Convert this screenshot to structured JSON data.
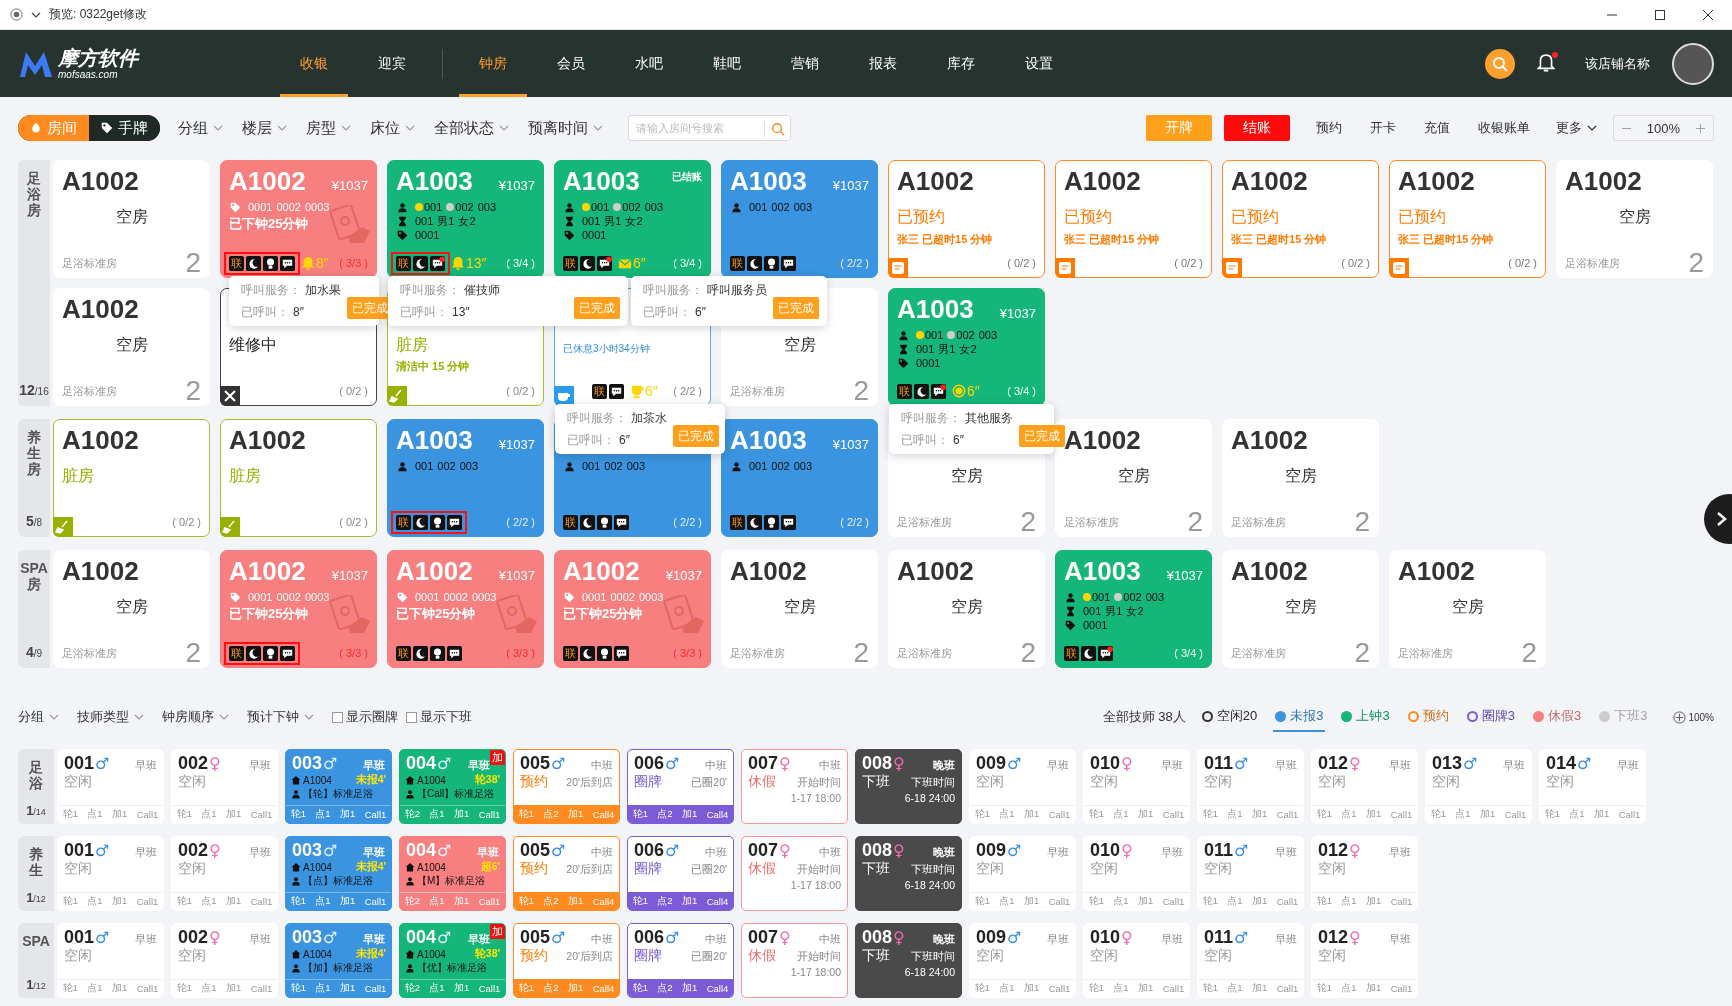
{
  "window": {
    "title": "预览: 0322get修改"
  },
  "nav": {
    "logo": "摩方软件",
    "logo_sub": "mofsaas.com",
    "modules": [
      {
        "label": "收银",
        "selected": true
      },
      {
        "label": "迎宾",
        "selected": false
      }
    ],
    "items": [
      {
        "label": "钟房",
        "selected": true
      },
      {
        "label": "会员",
        "selected": false
      },
      {
        "label": "水吧",
        "selected": false
      },
      {
        "label": "鞋吧",
        "selected": false
      },
      {
        "label": "营销",
        "selected": false
      },
      {
        "label": "报表",
        "selected": false
      },
      {
        "label": "库存",
        "selected": false
      },
      {
        "label": "设置",
        "selected": false
      }
    ],
    "store": "该店铺名称",
    "unread": true
  },
  "toolbar": {
    "modes": [
      {
        "label": "房间",
        "selected": true
      },
      {
        "label": "手牌",
        "selected": false
      }
    ],
    "filters": [
      "分组",
      "楼层",
      "房型",
      "床位",
      "全部状态",
      "预离时间"
    ],
    "search": {
      "placeholder": "请输入房间号搜索"
    },
    "buttons": [
      {
        "label": "开牌",
        "kind": "primary"
      },
      {
        "label": "结账",
        "kind": "danger"
      },
      {
        "label": "预约",
        "kind": "plain"
      },
      {
        "label": "开卡",
        "kind": "plain"
      },
      {
        "label": "充值",
        "kind": "plain"
      },
      {
        "label": "收银账单",
        "kind": "plain"
      },
      {
        "label": "更多",
        "kind": "menu"
      }
    ],
    "zoom": "100%"
  },
  "rooms": {
    "groups": [
      {
        "label": "足浴房",
        "count": "12",
        "total": "/16",
        "cards": [
          {
            "kind": "empty",
            "title": "A1002",
            "status": "空房",
            "type": "足浴标准房",
            "count": "2"
          },
          {
            "kind": "bill",
            "title": "A1002",
            "price": "¥1037",
            "lines": [
              {
                "kind": "tag",
                "parts": [
                  {
                    "text": "0001"
                  },
                  {
                    "text": "0002"
                  },
                  {
                    "text": "0003"
                  }
                ]
              }
            ],
            "note": "已下钟25分钟",
            "link": "联",
            "icons": [
              {
                "kind": "moon"
              },
              {
                "kind": "bulb"
              },
              {
                "kind": "chat"
              }
            ],
            "call": {
              "kind": "bell",
              "text": "8″"
            },
            "ratio": "( 3/3 )",
            "highlighted": true,
            "popup": {
              "service_label": "呼叫服务：",
              "service": "加水果",
              "called_label": "已呼叫：",
              "called": "8″",
              "button": "已完成"
            }
          },
          {
            "kind": "busy",
            "title": "A1003",
            "price": "¥1037",
            "lines": [
              {
                "kind": "person",
                "parts": [
                  {
                    "text": "001",
                    "color": "#ffd600"
                  },
                  {
                    "text": "002",
                    "color": "#cfcfcf"
                  },
                  {
                    "text": "003"
                  }
                ]
              },
              {
                "kind": "hourglass",
                "parts": [
                  {
                    "text": "001"
                  },
                  {
                    "text": "男1"
                  },
                  {
                    "text": "女2"
                  }
                ]
              },
              {
                "kind": "tag",
                "parts": [
                  {
                    "text": "0001"
                  }
                ]
              }
            ],
            "link": "联",
            "icons": [
              {
                "kind": "moon"
              },
              {
                "kind": "chat_dot"
              }
            ],
            "call": {
              "kind": "bell",
              "text": "13″"
            },
            "ratio": "( 3/4 )",
            "highlighted": true,
            "popup": {
              "service_label": "呼叫服务：",
              "service": "催技师",
              "called_label": "已呼叫：",
              "called": "13″",
              "button": "已完成"
            }
          },
          {
            "kind": "busy",
            "title": "A1003",
            "badge": "已结账",
            "lines": [
              {
                "kind": "person",
                "parts": [
                  {
                    "text": "001",
                    "color": "#ffd600"
                  },
                  {
                    "text": "002",
                    "color": "#cfcfcf"
                  },
                  {
                    "text": "003"
                  }
                ]
              },
              {
                "kind": "hourglass",
                "parts": [
                  {
                    "text": "001"
                  },
                  {
                    "text": "男1"
                  },
                  {
                    "text": "女2"
                  }
                ]
              },
              {
                "kind": "tag",
                "parts": [
                  {
                    "text": "0001"
                  }
                ]
              }
            ],
            "link": "联",
            "icons": [
              {
                "kind": "moon"
              },
              {
                "kind": "chat_dot"
              }
            ],
            "call": {
              "kind": "envelope",
              "text": "6″"
            },
            "ratio": "( 3/4 )",
            "highlighted": false,
            "popup": {
              "service_label": "呼叫服务：",
              "service": "呼叫服务员",
              "called_label": "已呼叫：",
              "called": "6″",
              "button": "已完成"
            }
          },
          {
            "kind": "running",
            "title": "A1003",
            "price": "¥1037",
            "lines": [
              {
                "kind": "person",
                "parts": [
                  {
                    "text": "001"
                  },
                  {
                    "text": "002"
                  },
                  {
                    "text": "003"
                  }
                ]
              }
            ],
            "link": "联",
            "icons": [
              {
                "kind": "moon"
              },
              {
                "kind": "bulb"
              },
              {
                "kind": "chat"
              }
            ],
            "ratio": "( 2/2 )",
            "highlighted": false
          },
          {
            "kind": "reserved",
            "title": "A1002",
            "status": "已预约",
            "note": "张三 已超时15 分钟",
            "ratio": "( 0/2 )"
          },
          {
            "kind": "reserved",
            "title": "A1002",
            "status": "已预约",
            "note": "张三 已超时15 分钟",
            "ratio": "( 0/2 )"
          },
          {
            "kind": "reserved",
            "title": "A1002",
            "status": "已预约",
            "note": "张三 已超时15 分钟",
            "ratio": "( 0/2 )"
          },
          {
            "kind": "reserved",
            "title": "A1002",
            "status": "已预约",
            "note": "张三 已超时15 分钟",
            "ratio": "( 0/2 )"
          },
          {
            "kind": "empty",
            "title": "A1002",
            "status": "空房",
            "type": "足浴标准房",
            "count": "2"
          },
          {
            "kind": "empty",
            "title": "A1002",
            "status": "空房",
            "type": "足浴标准房",
            "count": "2"
          },
          {
            "kind": "repair",
            "status": "维修中",
            "ratio": "( 0/2 )"
          },
          {
            "kind": "dirty",
            "status": "脏房",
            "note": "清洁中 15 分钟",
            "ratio": "( 0/2 )"
          },
          {
            "kind": "rest",
            "note": "已休息3小时34分钟",
            "link": "联",
            "icons": [
              {
                "kind": "chat"
              }
            ],
            "call": {
              "kind": "cup",
              "text": "6″"
            },
            "ratio": "( 2/2 )",
            "highlighted": false,
            "popup": {
              "service_label": "呼叫服务：",
              "service": "加茶水",
              "called_label": "已呼叫：",
              "called": "6″",
              "button": "已完成"
            }
          },
          {
            "kind": "empty",
            "status": "空房",
            "type": "足浴标准房",
            "count": "2"
          },
          {
            "kind": "busy",
            "title": "A1003",
            "price": "¥1037",
            "lines": [
              {
                "kind": "person",
                "parts": [
                  {
                    "text": "001",
                    "color": "#ffd600"
                  },
                  {
                    "text": "002",
                    "color": "#cfcfcf"
                  },
                  {
                    "text": "003"
                  }
                ]
              },
              {
                "kind": "hourglass",
                "parts": [
                  {
                    "text": "001"
                  },
                  {
                    "text": "男1"
                  },
                  {
                    "text": "女2"
                  }
                ]
              },
              {
                "kind": "tag",
                "parts": [
                  {
                    "text": "0001"
                  }
                ]
              }
            ],
            "link": "联",
            "icons": [
              {
                "kind": "moon"
              },
              {
                "kind": "chat_dot"
              }
            ],
            "call": {
              "kind": "circle",
              "text": "6″"
            },
            "ratio": "( 3/4 )",
            "highlighted": false,
            "popup": {
              "service_label": "呼叫服务：",
              "service": "其他服务",
              "called_label": "已呼叫：",
              "called": "6″",
              "button": "已完成"
            }
          }
        ]
      },
      {
        "label": "养生房",
        "count": "5",
        "total": "/8",
        "cards": [
          {
            "kind": "dirty",
            "title": "A1002",
            "status": "脏房",
            "ratio": "( 0/2 )"
          },
          {
            "kind": "dirty",
            "title": "A1002",
            "status": "脏房",
            "ratio": "( 0/2 )"
          },
          {
            "kind": "running",
            "title": "A1003",
            "price": "¥1037",
            "lines": [
              {
                "kind": "person",
                "parts": [
                  {
                    "text": "001"
                  },
                  {
                    "text": "002"
                  },
                  {
                    "text": "003"
                  }
                ]
              }
            ],
            "link": "联",
            "icons": [
              {
                "kind": "moon"
              },
              {
                "kind": "bulb"
              },
              {
                "kind": "chat"
              }
            ],
            "ratio": "( 2/2 )",
            "highlighted": true
          },
          {
            "kind": "running",
            "lines": [
              {
                "kind": "person",
                "parts": [
                  {
                    "text": "001"
                  },
                  {
                    "text": "002"
                  },
                  {
                    "text": "003"
                  }
                ]
              }
            ],
            "link": "联",
            "icons": [
              {
                "kind": "moon"
              },
              {
                "kind": "bulb"
              },
              {
                "kind": "chat"
              }
            ],
            "ratio": "( 2/2 )",
            "highlighted": false
          },
          {
            "kind": "running",
            "title": "A1003",
            "price": "¥1037",
            "lines": [
              {
                "kind": "person",
                "parts": [
                  {
                    "text": "001"
                  },
                  {
                    "text": "002"
                  },
                  {
                    "text": "003"
                  }
                ]
              }
            ],
            "link": "联",
            "icons": [
              {
                "kind": "moon"
              },
              {
                "kind": "bulb"
              },
              {
                "kind": "chat"
              }
            ],
            "ratio": "( 2/2 )",
            "highlighted": false
          },
          {
            "kind": "empty",
            "status": "空房",
            "type": "足浴标准房",
            "count": "2"
          },
          {
            "kind": "empty",
            "title": "A1002",
            "status": "空房",
            "type": "足浴标准房",
            "count": "2"
          },
          {
            "kind": "empty",
            "title": "A1002",
            "status": "空房",
            "type": "足浴标准房",
            "count": "2"
          }
        ]
      },
      {
        "label": "SPA房",
        "count": "4",
        "total": "/9",
        "cards": [
          {
            "kind": "empty",
            "title": "A1002",
            "status": "空房",
            "type": "足浴标准房",
            "count": "2"
          },
          {
            "kind": "bill",
            "title": "A1002",
            "price": "¥1037",
            "lines": [
              {
                "kind": "tag",
                "parts": [
                  {
                    "text": "0001"
                  },
                  {
                    "text": "0002"
                  },
                  {
                    "text": "0003"
                  }
                ]
              }
            ],
            "note": "已下钟25分钟",
            "link": "联",
            "icons": [
              {
                "kind": "moon"
              },
              {
                "kind": "bulb"
              },
              {
                "kind": "chat"
              }
            ],
            "ratio": "( 3/3 )",
            "highlighted": true
          },
          {
            "kind": "bill",
            "title": "A1002",
            "price": "¥1037",
            "lines": [
              {
                "kind": "tag",
                "parts": [
                  {
                    "text": "0001"
                  },
                  {
                    "text": "0002"
                  },
                  {
                    "text": "0003"
                  }
                ]
              }
            ],
            "note": "已下钟25分钟",
            "link": "联",
            "icons": [
              {
                "kind": "moon"
              },
              {
                "kind": "bulb"
              },
              {
                "kind": "chat"
              }
            ],
            "ratio": "( 3/3 )",
            "highlighted": false
          },
          {
            "kind": "bill",
            "title": "A1002",
            "price": "¥1037",
            "lines": [
              {
                "kind": "tag",
                "parts": [
                  {
                    "text": "0001"
                  },
                  {
                    "text": "0002"
                  },
                  {
                    "text": "0003"
                  }
                ]
              }
            ],
            "note": "已下钟25分钟",
            "link": "联",
            "icons": [
              {
                "kind": "moon"
              },
              {
                "kind": "bulb"
              },
              {
                "kind": "chat"
              }
            ],
            "ratio": "( 3/3 )",
            "highlighted": false
          },
          {
            "kind": "empty",
            "title": "A1002",
            "status": "空房",
            "type": "足浴标准房",
            "count": "2"
          },
          {
            "kind": "empty",
            "title": "A1002",
            "status": "空房",
            "type": "足浴标准房",
            "count": "2"
          },
          {
            "kind": "busy",
            "title": "A1003",
            "price": "¥1037",
            "lines": [
              {
                "kind": "person",
                "parts": [
                  {
                    "text": "001",
                    "color": "#ffd600"
                  },
                  {
                    "text": "002",
                    "color": "#cfcfcf"
                  },
                  {
                    "text": "003"
                  }
                ]
              },
              {
                "kind": "hourglass",
                "parts": [
                  {
                    "text": "001"
                  },
                  {
                    "text": "男1"
                  },
                  {
                    "text": "女2"
                  }
                ]
              },
              {
                "kind": "tag",
                "parts": [
                  {
                    "text": "0001"
                  }
                ]
              }
            ],
            "link": "联",
            "icons": [
              {
                "kind": "moon"
              },
              {
                "kind": "chat_dot"
              }
            ],
            "ratio": "( 3/4 )",
            "highlighted": false
          },
          {
            "kind": "empty",
            "title": "A1002",
            "status": "空房",
            "type": "足浴标准房",
            "count": "2"
          },
          {
            "kind": "empty",
            "title": "A1002",
            "status": "空房",
            "type": "足浴标准房",
            "count": "2"
          }
        ]
      }
    ]
  },
  "techs": {
    "filters": [
      "分组",
      "技师类型",
      "钟房顺序",
      "预计下钟"
    ],
    "options": [
      {
        "label": "显示圈牌",
        "checked": false
      },
      {
        "label": "显示下班",
        "checked": false
      }
    ],
    "summary": "全部技师 38人",
    "legend": [
      {
        "label": "空闲20",
        "kind": "ring",
        "color": "#333333",
        "selected": false
      },
      {
        "label": "未报3",
        "kind": "dot",
        "color": "#3a94e0",
        "selected": true
      },
      {
        "label": "上钟3",
        "kind": "dot",
        "color": "#15b67a",
        "selected": false
      },
      {
        "label": "预约",
        "kind": "ring",
        "color": "#ff8a1f",
        "selected": false
      },
      {
        "label": "圈牌3",
        "kind": "ring",
        "color": "#7c5cd6",
        "selected": false
      },
      {
        "label": "休假3",
        "kind": "dot",
        "color": "#f77f7f",
        "selected": false
      },
      {
        "label": "下班3",
        "kind": "dot",
        "color": "#cccccc",
        "selected": false
      }
    ],
    "zoom": "100%",
    "groups": [
      {
        "label": "足浴",
        "count": "1",
        "total": "/14",
        "cards": [
          {
            "kind": "idle",
            "num": "001",
            "sign": {
              "text": "♂",
              "color": "#3a8ee6"
            },
            "shift": "早班",
            "status": "空闲",
            "stats": [
              "轮1",
              "点1",
              "加1",
              "Call1"
            ]
          },
          {
            "kind": "idle",
            "num": "002",
            "sign": {
              "text": "♀",
              "color": "#f06ab0"
            },
            "shift": "早班",
            "status": "空闲",
            "stats": [
              "轮1",
              "点1",
              "加1",
              "Call1"
            ]
          },
          {
            "kind": "blue",
            "num": "003",
            "sign": {
              "text": "♂",
              "color": "#dbeeff"
            },
            "shift": "早班",
            "room": "A1004",
            "timer": "未报4'",
            "service": "【轮】标准足浴",
            "stats": [
              "轮1",
              "点1",
              "加1",
              "Call1"
            ]
          },
          {
            "kind": "green",
            "num": "004",
            "sign": {
              "text": "♂",
              "color": "#dbeeff"
            },
            "shift": "早班",
            "flag": "加",
            "room": "A1004",
            "timer": "轮38'",
            "service": "【Call】标准足浴",
            "stats": [
              "轮2",
              "点1",
              "加1",
              "Call1"
            ]
          },
          {
            "kind": "reserved",
            "num": "005",
            "sign": {
              "text": "♂",
              "color": "#3a8ee6"
            },
            "shift": "中班",
            "status": "预约",
            "info": "20'后到店",
            "stats": [
              "轮1",
              "点2",
              "加1",
              "Call4"
            ]
          },
          {
            "kind": "circled",
            "num": "006",
            "sign": {
              "text": "♂",
              "color": "#3a8ee6"
            },
            "shift": "中班",
            "status": "圈牌",
            "info": "已圈20'",
            "stats": [
              "轮1",
              "点2",
              "加1",
              "Call4"
            ]
          },
          {
            "kind": "leave",
            "num": "007",
            "sign": {
              "text": "♀",
              "color": "#f06ab0"
            },
            "shift": "中班",
            "status": "休假",
            "info": "开始时间",
            "time": "1-17 18:00"
          },
          {
            "kind": "off",
            "num": "008",
            "sign": {
              "text": "♀",
              "color": "#f06ab0"
            },
            "shift": "晚班",
            "status": "下班",
            "info": "下班时间",
            "time": "6-18 24:00"
          },
          {
            "kind": "idle",
            "num": "009",
            "sign": {
              "text": "♂",
              "color": "#3a8ee6"
            },
            "shift": "早班",
            "status": "空闲",
            "stats": [
              "轮1",
              "点1",
              "加1",
              "Call1"
            ]
          },
          {
            "kind": "idle",
            "num": "010",
            "sign": {
              "text": "♀",
              "color": "#f06ab0"
            },
            "shift": "早班",
            "status": "空闲",
            "stats": [
              "轮1",
              "点1",
              "加1",
              "Call1"
            ]
          },
          {
            "kind": "idle",
            "num": "011",
            "sign": {
              "text": "♂",
              "color": "#3a8ee6"
            },
            "shift": "早班",
            "status": "空闲",
            "stats": [
              "轮1",
              "点1",
              "加1",
              "Call1"
            ]
          },
          {
            "kind": "idle",
            "num": "012",
            "sign": {
              "text": "♀",
              "color": "#f06ab0"
            },
            "shift": "早班",
            "status": "空闲",
            "stats": [
              "轮1",
              "点1",
              "加1",
              "Call1"
            ]
          },
          {
            "kind": "idle",
            "num": "013",
            "sign": {
              "text": "♂",
              "color": "#3a8ee6"
            },
            "shift": "早班",
            "status": "空闲",
            "stats": [
              "轮1",
              "点1",
              "加1",
              "Call1"
            ]
          },
          {
            "kind": "idle",
            "num": "014",
            "sign": {
              "text": "♂",
              "color": "#3a8ee6"
            },
            "shift": "早班",
            "status": "空闲",
            "stats": [
              "轮1",
              "点1",
              "加1",
              "Call1"
            ]
          }
        ]
      },
      {
        "label": "养生",
        "count": "1",
        "total": "/12",
        "cards": [
          {
            "kind": "idle",
            "num": "001",
            "sign": {
              "text": "♂",
              "color": "#3a8ee6"
            },
            "shift": "早班",
            "status": "空闲",
            "stats": [
              "轮1",
              "点1",
              "加1",
              "Call1"
            ]
          },
          {
            "kind": "idle",
            "num": "002",
            "sign": {
              "text": "♀",
              "color": "#f06ab0"
            },
            "shift": "早班",
            "status": "空闲",
            "stats": [
              "轮1",
              "点1",
              "加1",
              "Call1"
            ]
          },
          {
            "kind": "blue",
            "num": "003",
            "sign": {
              "text": "♂",
              "color": "#dbeeff"
            },
            "shift": "早班",
            "room": "A1004",
            "timer": "未报4'",
            "service": "【点】标准足浴",
            "stats": [
              "轮1",
              "点1",
              "加1",
              "Call1"
            ]
          },
          {
            "kind": "red",
            "num": "004",
            "sign": {
              "text": "♂",
              "color": "#dbeeff"
            },
            "shift": "早班",
            "room": "A1004",
            "timer": "超6'",
            "service": "【M】标准足浴",
            "stats": [
              "轮2",
              "点1",
              "加1",
              "Call1"
            ]
          },
          {
            "kind": "reserved",
            "num": "005",
            "sign": {
              "text": "♂",
              "color": "#3a8ee6"
            },
            "shift": "中班",
            "status": "预约",
            "info": "20'后到店",
            "stats": [
              "轮1",
              "点2",
              "加1",
              "Call4"
            ]
          },
          {
            "kind": "circled",
            "num": "006",
            "sign": {
              "text": "♂",
              "color": "#3a8ee6"
            },
            "shift": "中班",
            "status": "圈牌",
            "info": "已圈20'",
            "stats": [
              "轮1",
              "点2",
              "加1",
              "Call4"
            ]
          },
          {
            "kind": "leave",
            "num": "007",
            "sign": {
              "text": "♀",
              "color": "#f06ab0"
            },
            "shift": "中班",
            "status": "休假",
            "info": "开始时间",
            "time": "1-17 18:00"
          },
          {
            "kind": "off",
            "num": "008",
            "sign": {
              "text": "♀",
              "color": "#f06ab0"
            },
            "shift": "晚班",
            "status": "下班",
            "info": "下班时间",
            "time": "6-18 24:00"
          },
          {
            "kind": "idle",
            "num": "009",
            "sign": {
              "text": "♂",
              "color": "#3a8ee6"
            },
            "shift": "早班",
            "status": "空闲",
            "stats": [
              "轮1",
              "点1",
              "加1",
              "Call1"
            ]
          },
          {
            "kind": "idle",
            "num": "010",
            "sign": {
              "text": "♀",
              "color": "#f06ab0"
            },
            "shift": "早班",
            "status": "空闲",
            "stats": [
              "轮1",
              "点1",
              "加1",
              "Call1"
            ]
          },
          {
            "kind": "idle",
            "num": "011",
            "sign": {
              "text": "♂",
              "color": "#3a8ee6"
            },
            "shift": "早班",
            "status": "空闲",
            "stats": [
              "轮1",
              "点1",
              "加1",
              "Call1"
            ]
          },
          {
            "kind": "idle",
            "num": "012",
            "sign": {
              "text": "♀",
              "color": "#f06ab0"
            },
            "shift": "早班",
            "status": "空闲",
            "stats": [
              "轮1",
              "点1",
              "加1",
              "Call1"
            ]
          }
        ]
      },
      {
        "label": "SPA",
        "count": "1",
        "total": "/12",
        "cards": [
          {
            "kind": "idle",
            "num": "001",
            "sign": {
              "text": "♂",
              "color": "#3a8ee6"
            },
            "shift": "早班",
            "status": "空闲",
            "stats": [
              "轮1",
              "点1",
              "加1",
              "Call1"
            ]
          },
          {
            "kind": "idle",
            "num": "002",
            "sign": {
              "text": "♀",
              "color": "#f06ab0"
            },
            "shift": "早班",
            "status": "空闲",
            "stats": [
              "轮1",
              "点1",
              "加1",
              "Call1"
            ]
          },
          {
            "kind": "blue",
            "num": "003",
            "sign": {
              "text": "♂",
              "color": "#dbeeff"
            },
            "shift": "早班",
            "room": "A1004",
            "timer": "未报4'",
            "service": "【加】标准足浴",
            "stats": [
              "轮1",
              "点1",
              "加1",
              "Call1"
            ]
          },
          {
            "kind": "green",
            "num": "004",
            "sign": {
              "text": "♂",
              "color": "#dbeeff"
            },
            "shift": "早班",
            "flag": "加",
            "room": "A1004",
            "timer": "轮38'",
            "service": "【优】标准足浴",
            "stats": [
              "轮2",
              "点1",
              "加1",
              "Call1"
            ]
          },
          {
            "kind": "reserved",
            "num": "005",
            "sign": {
              "text": "♂",
              "color": "#3a8ee6"
            },
            "shift": "中班",
            "status": "预约",
            "info": "20'后到店",
            "stats": [
              "轮1",
              "点2",
              "加1",
              "Call4"
            ]
          },
          {
            "kind": "circled",
            "num": "006",
            "sign": {
              "text": "♂",
              "color": "#3a8ee6"
            },
            "shift": "中班",
            "status": "圈牌",
            "info": "已圈20'",
            "stats": [
              "轮1",
              "点2",
              "加1",
              "Call4"
            ]
          },
          {
            "kind": "leave",
            "num": "007",
            "sign": {
              "text": "♀",
              "color": "#f06ab0"
            },
            "shift": "中班",
            "status": "休假",
            "info": "开始时间",
            "time": "1-17 18:00"
          },
          {
            "kind": "off",
            "num": "008",
            "sign": {
              "text": "♀",
              "color": "#f06ab0"
            },
            "shift": "晚班",
            "status": "下班",
            "info": "下班时间",
            "time": "6-18 24:00"
          },
          {
            "kind": "idle",
            "num": "009",
            "sign": {
              "text": "♂",
              "color": "#3a8ee6"
            },
            "shift": "早班",
            "status": "空闲",
            "stats": [
              "轮1",
              "点1",
              "加1",
              "Call1"
            ]
          },
          {
            "kind": "idle",
            "num": "010",
            "sign": {
              "text": "♀",
              "color": "#f06ab0"
            },
            "shift": "早班",
            "status": "空闲",
            "stats": [
              "轮1",
              "点1",
              "加1",
              "Call1"
            ]
          },
          {
            "kind": "idle",
            "num": "011",
            "sign": {
              "text": "♂",
              "color": "#3a8ee6"
            },
            "shift": "早班",
            "status": "空闲",
            "stats": [
              "轮1",
              "点1",
              "加1",
              "Call1"
            ]
          },
          {
            "kind": "idle",
            "num": "012",
            "sign": {
              "text": "♀",
              "color": "#f06ab0"
            },
            "shift": "早班",
            "status": "空闲",
            "stats": [
              "轮1",
              "点1",
              "加1",
              "Call1"
            ]
          }
        ]
      }
    ]
  }
}
